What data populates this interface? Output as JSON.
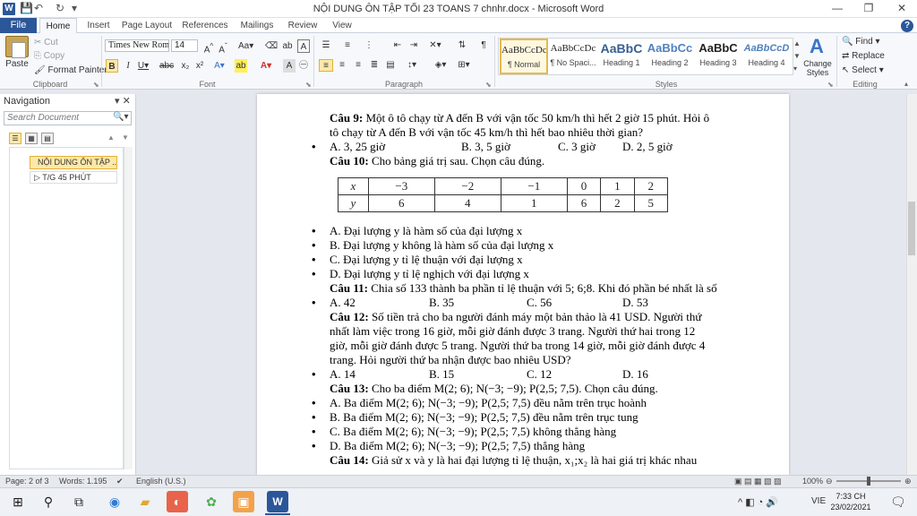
{
  "titlebar": {
    "title": "NỘI DUNG ÔN TẬP TỐI 23 TOANS 7 chnhr.docx  -  Microsoft Word",
    "app_icon": "W",
    "minimize": "—",
    "restore": "❐",
    "close": "✕"
  },
  "ribbon_tabs": [
    "File",
    "Home",
    "Insert",
    "Page Layout",
    "References",
    "Mailings",
    "Review",
    "View"
  ],
  "clipboard": {
    "paste": "Paste",
    "cut": "Cut",
    "copy": "Copy",
    "format_painter": "Format Painter",
    "label": "Clipboard"
  },
  "font": {
    "name": "Times New Rom",
    "size": "14",
    "label": "Font"
  },
  "paragraph": {
    "label": "Paragraph"
  },
  "styles": {
    "label": "Styles",
    "items": [
      {
        "preview": "AaBbCcDc",
        "name": "¶ Normal"
      },
      {
        "preview": "AaBbCcDc",
        "name": "¶ No Spaci..."
      },
      {
        "preview": "AaBbC",
        "name": "Heading 1"
      },
      {
        "preview": "AaBbCc",
        "name": "Heading 2"
      },
      {
        "preview": "AaBbC",
        "name": "Heading 3"
      },
      {
        "preview": "AaBbCcD",
        "name": "Heading 4"
      }
    ],
    "change_styles": "Change Styles"
  },
  "editing": {
    "find": "Find",
    "replace": "Replace",
    "select": "Select",
    "label": "Editing"
  },
  "navigation": {
    "title": "Navigation",
    "search_placeholder": "Search Document",
    "headings": [
      "NỘI DUNG ÔN TẬP ...",
      "T/G 45 PHÚT"
    ]
  },
  "document": {
    "q9_label": "Câu 9:",
    "q9_text": " Một ô tô chạy từ A đến B với vận tốc 50 km/h thì hết 2 giờ 15 phút. Hỏi ô",
    "q9_text2": "tô chạy từ A đến B với vận tốc 45 km/h thì hết bao nhiêu thời gian?",
    "q9_opts": [
      "A. 3, 25 giờ",
      "B. 3, 5 giờ",
      "C. 3 giờ",
      "D. 2, 5 giờ"
    ],
    "q10_label": "Câu 10:",
    "q10_text": " Cho bảng giá trị sau. Chọn câu đúng.",
    "table": {
      "x_label": "x",
      "y_label": "y",
      "x": [
        "−3",
        "−2",
        "−1",
        "0",
        "1",
        "2"
      ],
      "y": [
        "6",
        "4",
        "1",
        "6",
        "2",
        "5"
      ]
    },
    "q10_opts": [
      "A. Đại lượng y là hàm số của đại lượng x",
      "B. Đại lượng y không là hàm số của đại lượng x",
      "C. Đại lượng y tỉ lệ thuận với đại lượng x",
      "D. Đại lượng y tỉ lệ nghịch với đại lượng x"
    ],
    "q11_label": "Câu 11:",
    "q11_text": "  Chia số 133 thành ba phần tỉ lệ thuận với 5; 6;8. Khi đó phần bé nhất là số",
    "q11_opts": [
      "A. 42",
      "B. 35",
      "C. 56",
      "D. 53"
    ],
    "q12_label": "Câu 12:",
    "q12_lines": [
      " Số tiền trả cho ba người đánh máy một bản thảo là 41 USD. Người thứ",
      "nhất làm việc trong 16 giờ, mỗi giờ đánh được 3 trang. Người thứ hai trong 12",
      "giờ, mỗi giờ đánh được 5 trang. Người thứ ba trong 14 giờ, mỗi giờ đánh được 4",
      "trang. Hỏi người thứ ba nhận được bao nhiêu USD?"
    ],
    "q12_opts": [
      "A. 14",
      "B. 15",
      "C. 12",
      "D. 16"
    ],
    "q13_label": "Câu 13:",
    "q13_text": " Cho ba điểm M(2; 6); N(−3; −9); P(2,5; 7,5). Chọn câu đúng.",
    "q13_opts": [
      "A. Ba điểm M(2; 6); N(−3; −9); P(2,5; 7,5) đều nằm trên trục hoành",
      "B. Ba điểm M(2; 6); N(−3; −9); P(2,5; 7,5) đều nằm trên trục tung",
      "C. Ba điểm M(2; 6); N(−3; −9); P(2,5; 7,5) không thẳng hàng",
      "D. Ba điểm M(2; 6); N(−3; −9); P(2,5; 7,5) thẳng hàng"
    ],
    "q14_label": "Câu 14:",
    "q14_text": " Giả sử x và y là hai đại lượng tỉ lệ thuận, x₁;x₂ là hai giá trị khác nhau"
  },
  "status": {
    "page": "Page: 2 of 3",
    "words": "Words: 1.195",
    "language": "English (U.S.)",
    "zoom": "100%"
  },
  "taskbar": {
    "lang": "VIE",
    "time": "7:33 CH",
    "date": "23/02/2021"
  },
  "colors": {
    "word_blue": "#2b579a",
    "highlight": "#fce8a8"
  }
}
